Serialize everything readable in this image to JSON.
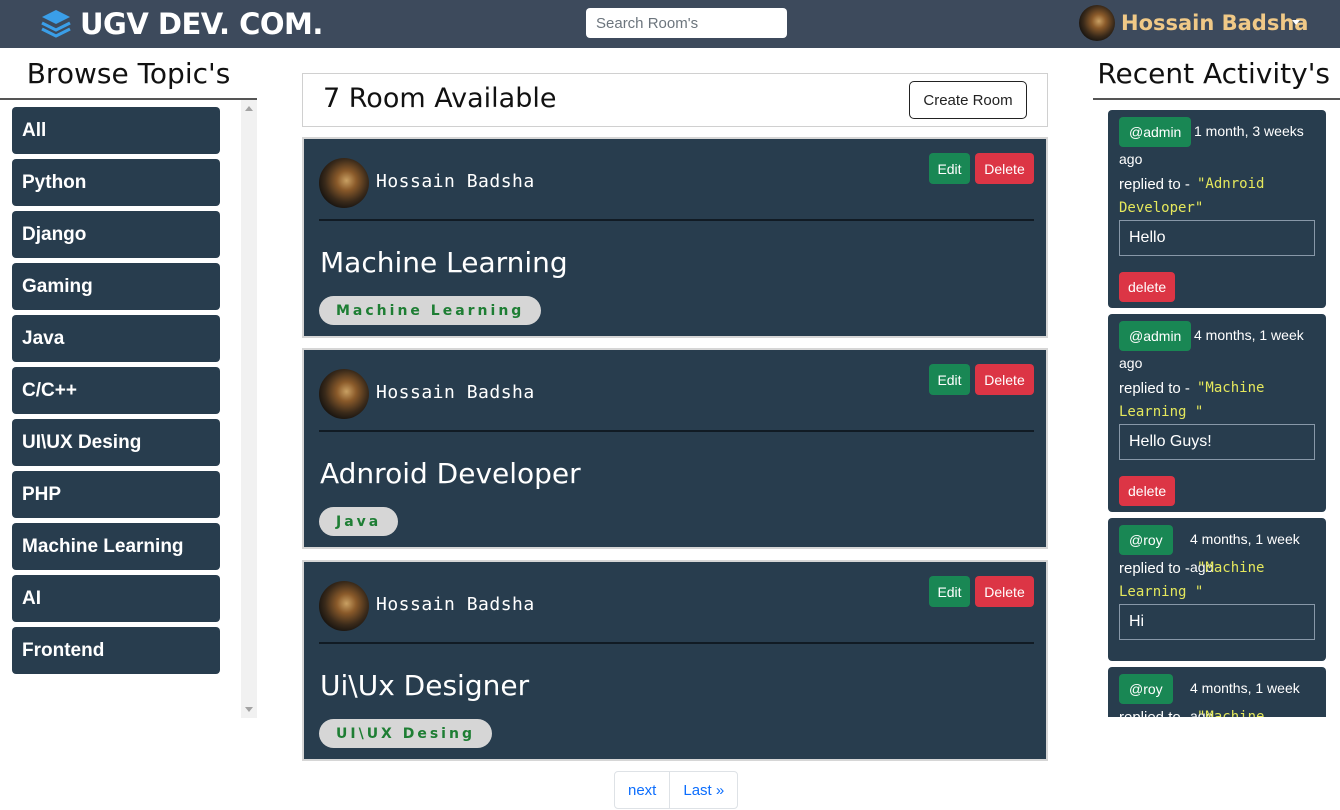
{
  "brand": {
    "name": "UGV DEV. COM."
  },
  "search": {
    "placeholder": "Search Room's"
  },
  "user": {
    "name": "Hossain Badsha"
  },
  "topics": {
    "heading": "Browse Topic's",
    "items": [
      "All",
      "Python",
      "Django",
      "Gaming",
      "Java",
      "C/C++",
      "UI\\UX Desing",
      "PHP",
      "Machine Learning",
      "AI",
      "Frontend"
    ]
  },
  "rooms": {
    "count_text": "7 Room Available",
    "create_label": "Create Room",
    "edit_label": "Edit",
    "delete_label": "Delete",
    "items": [
      {
        "host": "Hossain Badsha",
        "title": "Machine Learning",
        "topic": "Machine Learning"
      },
      {
        "host": "Hossain Badsha",
        "title": "Adnroid Developer",
        "topic": "Java"
      },
      {
        "host": "Hossain Badsha",
        "title": "Ui\\Ux Designer",
        "topic": "UI\\UX Desing"
      }
    ]
  },
  "pagination": {
    "next": "next",
    "last": "Last »"
  },
  "activity": {
    "heading": "Recent Activity's",
    "replied_label": "replied to -",
    "delete_label": "delete",
    "items": [
      {
        "user": "@admin",
        "time": "1 month, 3 weeks ago",
        "room": "\"Adnroid Developer\"",
        "message": "Hello"
      },
      {
        "user": "@admin",
        "time": "4 months, 1 week ago",
        "room": "\"Machine Learning \"",
        "message": "Hello Guys!"
      },
      {
        "user": "@roy",
        "time": "4 months, 1 week ago",
        "room": "\"Machine Learning \"",
        "message": "Hi"
      },
      {
        "user": "@roy",
        "time": "4 months, 1 week ago",
        "room": "\"Machine",
        "message": ""
      }
    ]
  }
}
